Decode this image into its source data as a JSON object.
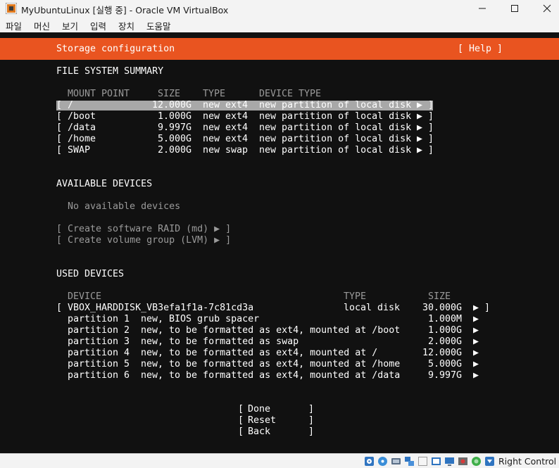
{
  "window": {
    "title": "MyUbuntuLinux [실행 중] - Oracle VM VirtualBox"
  },
  "menu": [
    "파일",
    "머신",
    "보기",
    "입력",
    "장치",
    "도움말"
  ],
  "installer": {
    "header_title": "Storage configuration",
    "help_label": "[ Help ]",
    "fs_summary": {
      "heading": "FILE SYSTEM SUMMARY",
      "columns": [
        "MOUNT POINT",
        "SIZE",
        "TYPE",
        "DEVICE TYPE"
      ],
      "rows": [
        {
          "open": "[",
          "mount": "/",
          "size": "12.000G",
          "type": "new ext4",
          "device": "new partition of local disk",
          "arrow": "▶",
          "close": "]"
        },
        {
          "open": "[",
          "mount": "/boot",
          "size": "1.000G",
          "type": "new ext4",
          "device": "new partition of local disk",
          "arrow": "▶",
          "close": "]"
        },
        {
          "open": "[",
          "mount": "/data",
          "size": "9.997G",
          "type": "new ext4",
          "device": "new partition of local disk",
          "arrow": "▶",
          "close": "]"
        },
        {
          "open": "[",
          "mount": "/home",
          "size": "5.000G",
          "type": "new ext4",
          "device": "new partition of local disk",
          "arrow": "▶",
          "close": "]"
        },
        {
          "open": "[",
          "mount": "SWAP",
          "size": "2.000G",
          "type": "new swap",
          "device": "new partition of local disk",
          "arrow": "▶",
          "close": "]"
        }
      ]
    },
    "available": {
      "heading": "AVAILABLE DEVICES",
      "empty_text": "No available devices",
      "actions": [
        "[ Create software RAID (md) ▶ ]",
        "[ Create volume group (LVM) ▶ ]"
      ]
    },
    "used": {
      "heading": "USED DEVICES",
      "columns": [
        "DEVICE",
        "TYPE",
        "SIZE"
      ],
      "disk": {
        "open": "[",
        "name": "VBOX_HARDDISK_VB3efa1f1a-7c81cd3a",
        "type": "local disk",
        "size": "30.000G",
        "arrow": "▶",
        "close": "]"
      },
      "partitions": [
        {
          "name": "partition 1",
          "desc": "new, BIOS grub spacer",
          "size": "1.000M",
          "arrow": "▶"
        },
        {
          "name": "partition 2",
          "desc": "new, to be formatted as ext4, mounted at /boot",
          "size": "1.000G",
          "arrow": "▶"
        },
        {
          "name": "partition 3",
          "desc": "new, to be formatted as swap",
          "size": "2.000G",
          "arrow": "▶"
        },
        {
          "name": "partition 4",
          "desc": "new, to be formatted as ext4, mounted at /",
          "size": "12.000G",
          "arrow": "▶"
        },
        {
          "name": "partition 5",
          "desc": "new, to be formatted as ext4, mounted at /home",
          "size": "5.000G",
          "arrow": "▶"
        },
        {
          "name": "partition 6",
          "desc": "new, to be formatted as ext4, mounted at /data",
          "size": "9.997G",
          "arrow": "▶"
        }
      ]
    },
    "buttons": [
      {
        "open": "[",
        "label": "Done",
        "close": "]"
      },
      {
        "open": "[",
        "label": "Reset",
        "close": "]"
      },
      {
        "open": "[",
        "label": "Back",
        "close": "]"
      }
    ]
  },
  "statusbar": {
    "icons": [
      "hard-disk-icon",
      "optical-drive-icon",
      "audio-icon",
      "network-icon",
      "usb-icon",
      "shared-folders-icon",
      "display-icon",
      "video-capture-icon",
      "cpu-icon",
      "mouse-integration-icon",
      "keyboard-icon",
      "arrow-down-icon"
    ],
    "host_key": "Right Control"
  },
  "colors": {
    "accent": "#e95420",
    "terminal_bg": "#111111",
    "selection": "#a8a8a8"
  }
}
